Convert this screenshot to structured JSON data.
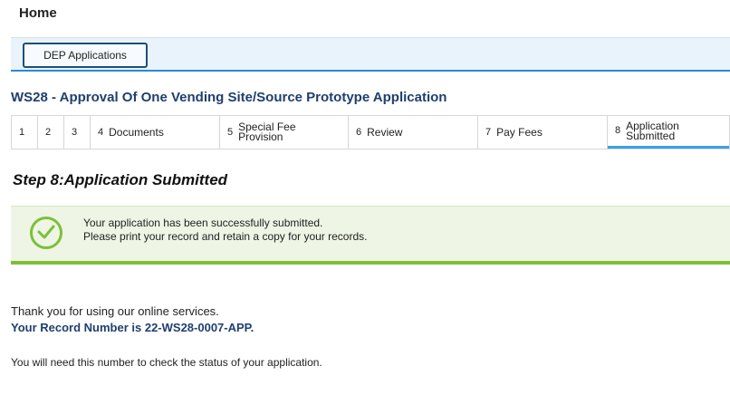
{
  "header": {
    "home": "Home"
  },
  "nav": {
    "dep_applications": "DEP Applications"
  },
  "application": {
    "title": "WS28 - Approval Of One Vending Site/Source Prototype Application"
  },
  "steps": [
    {
      "num": "1",
      "label": ""
    },
    {
      "num": "2",
      "label": ""
    },
    {
      "num": "3",
      "label": ""
    },
    {
      "num": "4",
      "label": "Documents"
    },
    {
      "num": "5",
      "label": "Special Fee\nProvision"
    },
    {
      "num": "6",
      "label": "Review"
    },
    {
      "num": "7",
      "label": "Pay Fees"
    },
    {
      "num": "8",
      "label": "Application\nSubmitted"
    }
  ],
  "step_heading": "Step 8:Application Submitted",
  "success": {
    "line1": "Your application has been successfully submitted.",
    "line2": "Please print your record and retain a copy for your records."
  },
  "footer": {
    "thanks": "Thank you for using our online services.",
    "record_number": "Your Record Number is 22-WS28-0007-APP.",
    "need_number": "You will need this number to check the status of your application."
  },
  "colors": {
    "accent": "#2a8ad8",
    "success": "#7cc03a",
    "title": "#1f3f6e"
  }
}
